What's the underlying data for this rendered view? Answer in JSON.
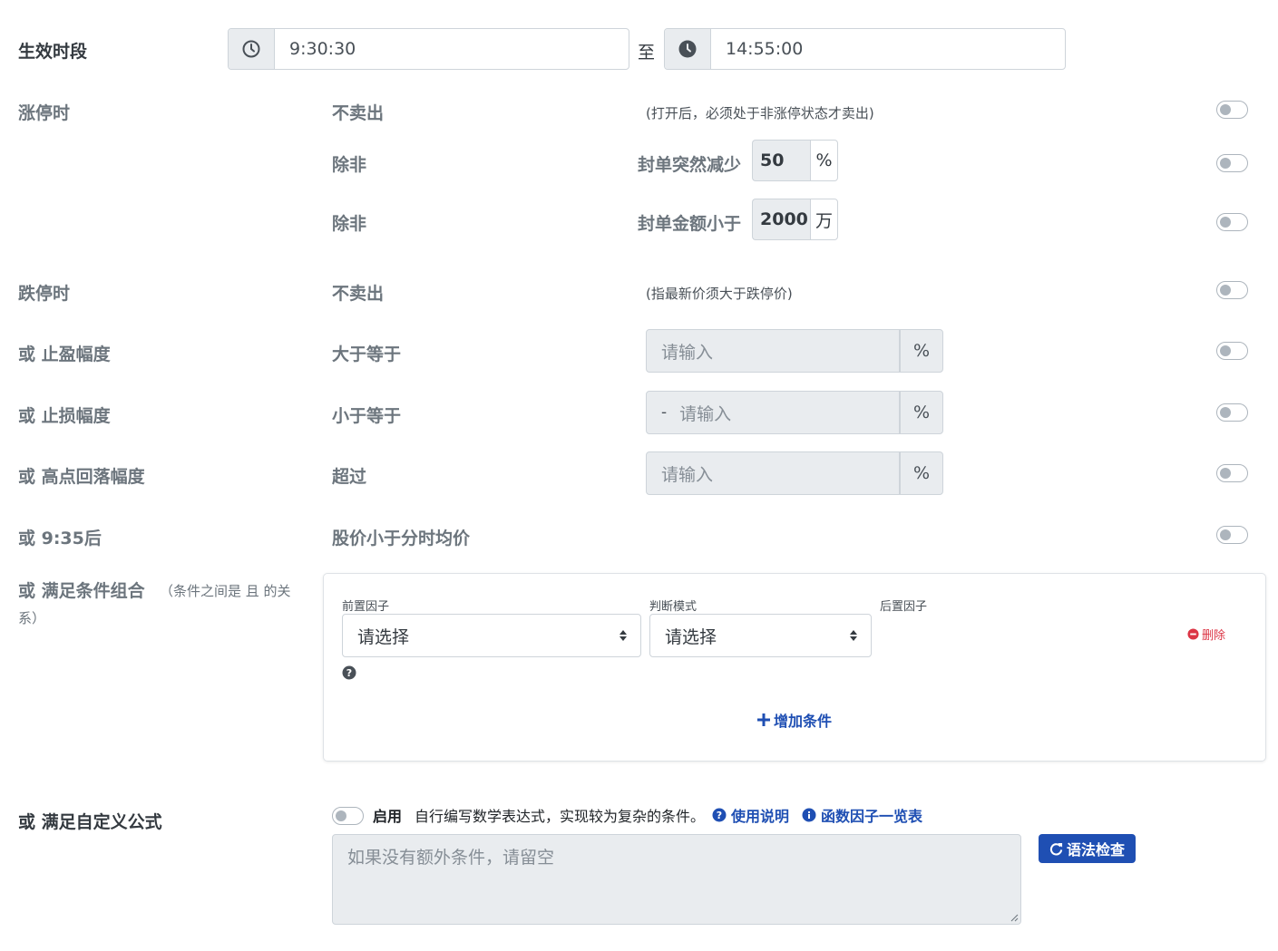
{
  "effective_period": {
    "label": "生效时段",
    "start_time": "9:30:30",
    "separator": "至",
    "end_time": "14:55:00"
  },
  "limit_up": {
    "label": "涨停时",
    "no_sell": "不卖出",
    "no_sell_hint": "(打开后，必须处于非涨停状态才卖出)",
    "unless_label": "除非",
    "seal_drop_label": "封单突然减少",
    "seal_drop_value": "50",
    "seal_drop_unit": "%",
    "seal_amount_label": "封单金额小于",
    "seal_amount_value": "2000",
    "seal_amount_unit": "万"
  },
  "limit_down": {
    "label": "跌停时",
    "no_sell": "不卖出",
    "hint": "(指最新价须大于跌停价)"
  },
  "take_profit": {
    "label": "或 止盈幅度",
    "op": "大于等于",
    "placeholder": "请输入",
    "unit": "%"
  },
  "stop_loss": {
    "label": "或 止损幅度",
    "op": "小于等于",
    "prefix": "-",
    "placeholder": "请输入",
    "unit": "%"
  },
  "high_pullback": {
    "label": "或 高点回落幅度",
    "op": "超过",
    "placeholder": "请输入",
    "unit": "%"
  },
  "after_935": {
    "label": "或 9:35后",
    "desc": "股价小于分时均价"
  },
  "condition_combo": {
    "label": "或 满足条件组合",
    "hint_line1": "（条件之间是 且 的关",
    "hint_line2": "系）",
    "front_factor_label": "前置因子",
    "judge_mode_label": "判断模式",
    "back_factor_label": "后置因子",
    "front_factor_value": "请选择",
    "judge_mode_value": "请选择",
    "delete_label": "删除",
    "add_condition_label": "增加条件"
  },
  "custom_formula": {
    "label": "或 满足自定义公式",
    "enable_label": "启用",
    "desc": "自行编写数学表达式，实现较为复杂的条件。",
    "usage_link": "使用说明",
    "factor_list_link": "函数因子一览表",
    "placeholder": "如果没有额外条件，请留空",
    "syntax_check_button": "语法检查"
  },
  "colors": {
    "primary": "#1f4fb3",
    "danger": "#dc3545",
    "muted": "#6c757d",
    "input_bg": "#e9ecef"
  },
  "toggles": {
    "limit_up_no_sell": false,
    "seal_drop": false,
    "seal_amount": false,
    "limit_down_no_sell": false,
    "take_profit": false,
    "stop_loss": false,
    "high_pullback": false,
    "after_935": false,
    "custom_formula": false
  }
}
